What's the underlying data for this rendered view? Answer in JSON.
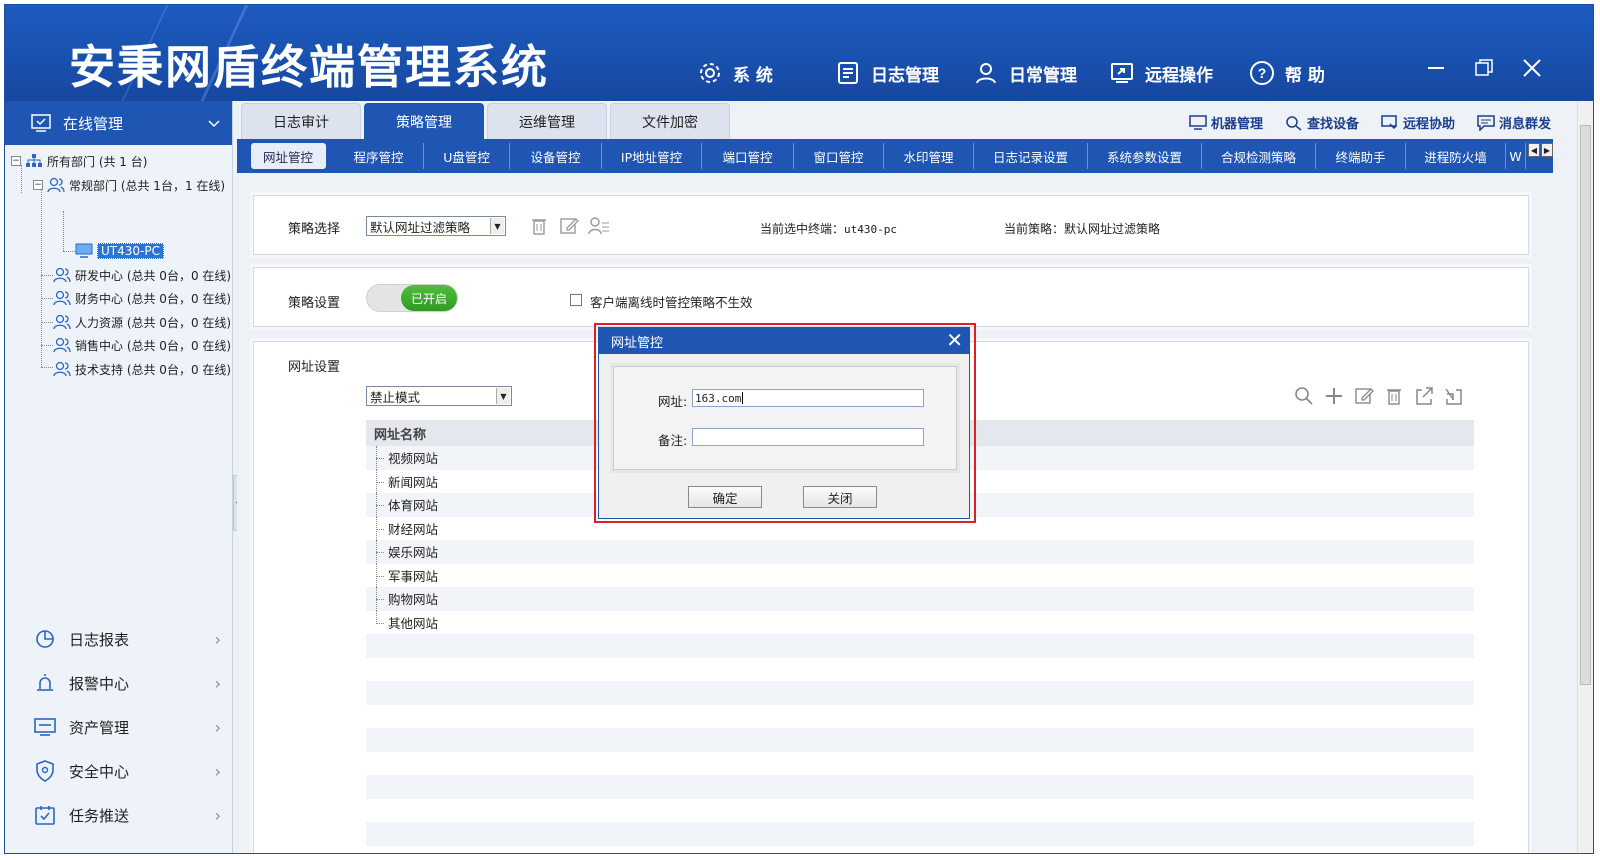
{
  "header": {
    "title": "安秉网盾终端管理系统",
    "nav": [
      {
        "label": "系 统",
        "icon": "gear-icon"
      },
      {
        "label": "日志管理",
        "icon": "log-icon"
      },
      {
        "label": "日常管理",
        "icon": "user-icon"
      },
      {
        "label": "远程操作",
        "icon": "remote-icon"
      },
      {
        "label": "帮 助",
        "icon": "help-icon"
      }
    ]
  },
  "sidebar": {
    "section_title": "在线管理",
    "tree": {
      "root": "所有部门 (共 1 台)",
      "group": "常规部门 (总共 1台，1 在线)",
      "selected": "UT430-PC",
      "depts": [
        "研发中心 (总共 0台，0 在线)",
        "财务中心 (总共 0台，0 在线)",
        "人力资源 (总共 0台，0 在线)",
        "销售中心 (总共 0台，0 在线)",
        "技术支持 (总共 0台，0 在线)"
      ]
    },
    "menu": [
      {
        "label": "日志报表"
      },
      {
        "label": "报警中心"
      },
      {
        "label": "资产管理"
      },
      {
        "label": "安全中心"
      },
      {
        "label": "任务推送"
      }
    ]
  },
  "main_tabs": [
    "日志审计",
    "策略管理",
    "运维管理",
    "文件加密"
  ],
  "tools": [
    "机器管理",
    "查找设备",
    "远程协助",
    "消息群发"
  ],
  "sub_tabs": [
    "网址管控",
    "程序管控",
    "U盘管控",
    "设备管控",
    "IP地址管控",
    "端口管控",
    "窗口管控",
    "水印管理",
    "日志记录设置",
    "系统参数设置",
    "合规检测策略",
    "终端助手",
    "进程防火墙",
    "W"
  ],
  "policy": {
    "select_label": "策略选择",
    "select_value": "默认网址过滤策略",
    "current_terminal_label": "当前选中终端：",
    "current_terminal": "ut430-pc",
    "current_policy_label": "当前策略：",
    "current_policy": "默认网址过滤策略"
  },
  "settings": {
    "label": "策略设置",
    "toggle": "已开启",
    "checkbox": "客户端离线时管控策略不生效"
  },
  "url": {
    "label": "网址设置",
    "mode": "禁止模式",
    "column": "网址名称",
    "rows": [
      "视频网站",
      "新闻网站",
      "体育网站",
      "财经网站",
      "娱乐网站",
      "军事网站",
      "购物网站",
      "其他网站"
    ]
  },
  "dialog": {
    "title": "网址管控",
    "url_label": "网址:",
    "url_value": "163.com",
    "note_label": "备注:",
    "note_value": "",
    "ok": "确定",
    "close": "关闭"
  },
  "colors": {
    "primary": "#1f56b3",
    "toggle_on": "#3aa92c",
    "highlight": "#e02020"
  }
}
